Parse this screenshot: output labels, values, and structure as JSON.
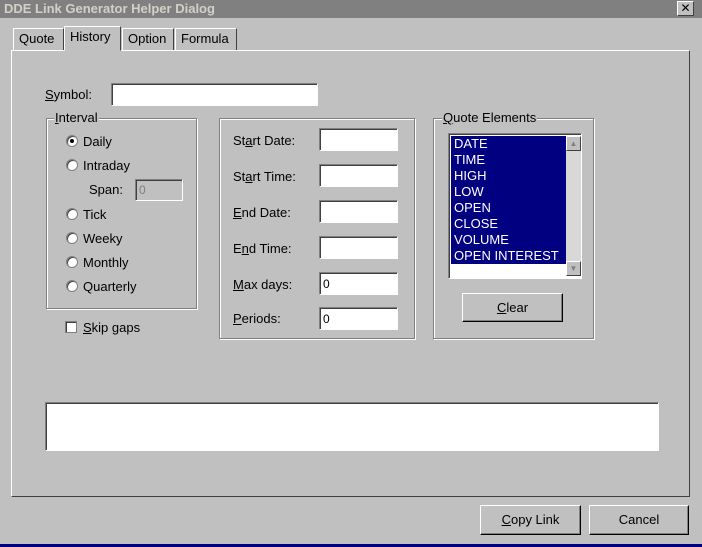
{
  "window": {
    "title": "DDE Link Generator Helper Dialog",
    "close_glyph": "✕"
  },
  "tabs": [
    {
      "label": "Quote"
    },
    {
      "label": "History",
      "active": true
    },
    {
      "label": "Option"
    },
    {
      "label": "Formula"
    }
  ],
  "symbol": {
    "label_ul": "S",
    "label_rest": "ymbol:",
    "value": ""
  },
  "interval": {
    "legend_ul": "I",
    "legend_rest": "nterval",
    "options": [
      {
        "label": "Daily",
        "selected": true
      },
      {
        "label": "Intraday",
        "selected": false
      },
      {
        "label": "Tick",
        "selected": false
      },
      {
        "label": "Weeky",
        "selected": false
      },
      {
        "label": "Monthly",
        "selected": false
      },
      {
        "label": "Quarterly",
        "selected": false
      }
    ],
    "span_label": "Span:",
    "span_value": "0"
  },
  "skip_gaps": {
    "label_ul": "S",
    "label_rest": "kip gaps",
    "checked": false
  },
  "range": {
    "start_date": {
      "pre": "St",
      "ul": "a",
      "post": "rt Date:",
      "value": ""
    },
    "start_time": {
      "pre": "St",
      "ul": "a",
      "post": "rt Time:",
      "value": ""
    },
    "end_date": {
      "pre": "",
      "ul": "E",
      "post": "nd Date:",
      "value": ""
    },
    "end_time": {
      "pre": "E",
      "ul": "n",
      "post": "d Time:",
      "value": ""
    },
    "max_days": {
      "pre": "",
      "ul": "M",
      "post": "ax days:",
      "value": "0"
    },
    "periods": {
      "pre": "",
      "ul": "P",
      "post": "eriods:",
      "value": "0"
    }
  },
  "quote_elements": {
    "legend_ul": "Q",
    "legend_rest": "uote Elements",
    "items": [
      "DATE",
      "TIME",
      "HIGH",
      "LOW",
      "OPEN",
      "CLOSE",
      "VOLUME",
      "OPEN INTEREST"
    ],
    "clear_ul": "C",
    "clear_rest": "lear"
  },
  "footer": {
    "copy_link_ul": "C",
    "copy_link_rest": "opy Link",
    "cancel_label": "Cancel"
  },
  "colors": {
    "face": "#c0c0c0",
    "selection": "#000080",
    "title_inactive": "#808080"
  }
}
